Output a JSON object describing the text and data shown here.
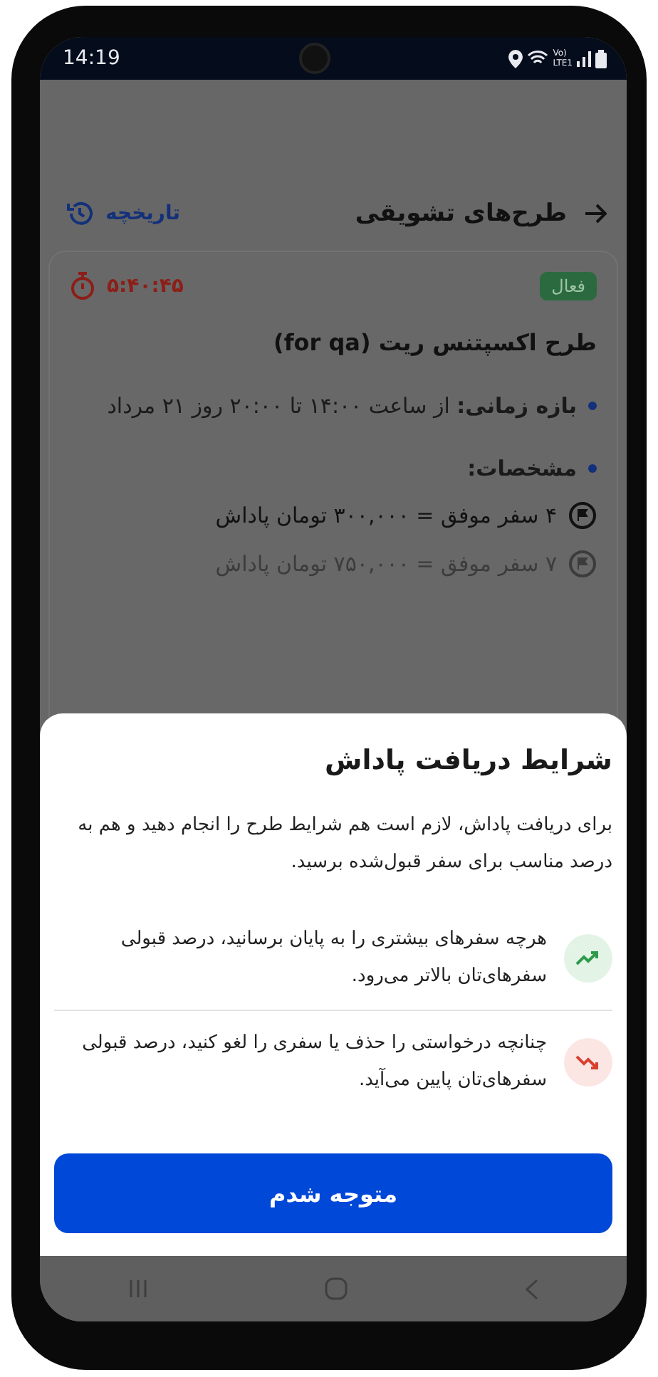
{
  "status_bar": {
    "time": "14:19",
    "volte": "Vo)",
    "network": "LTE1"
  },
  "header": {
    "title": "طرح‌های تشویقی",
    "history_link": "تاریخچه"
  },
  "campaign": {
    "status_badge": "فعال",
    "countdown": "۵:۴۰:۴۵",
    "title": "طرح اکسپتنس ریت (for qa)",
    "details": [
      {
        "kind": "text",
        "text": "**بازه زمانی:** از ساعت ۱۴:۰۰ تا ۲۰:۰۰ روز ۲۱ مرداد"
      },
      {
        "kind": "text",
        "text": "**مشخصات:**"
      }
    ],
    "tiers": [
      {
        "text": "۴ سفر موفق = ۳۰۰,۰۰۰ تومان پاداش",
        "active": true
      },
      {
        "text": "۷ سفر موفق = ۷۵۰,۰۰۰ تومان پاداش",
        "active": false
      }
    ]
  },
  "sheet": {
    "title": "شرایط دریافت پاداش",
    "description": "برای دریافت پاداش، لازم است هم شرایط طرح را انجام دهید و هم به درصد مناسب برای سفر قبول‌شده برسید.",
    "tips": [
      {
        "kind": "up",
        "text": "هرچه سفرهای بیشتری را به پایان برسانید، درصد قبولی سفرهای‌تان بالاتر می‌رود."
      },
      {
        "kind": "down",
        "text": "چنانچه درخواستی را حذف یا سفری را لغو کنید، درصد قبولی سفرهای‌تان پایین می‌آید."
      }
    ],
    "button": "متوجه شدم"
  }
}
